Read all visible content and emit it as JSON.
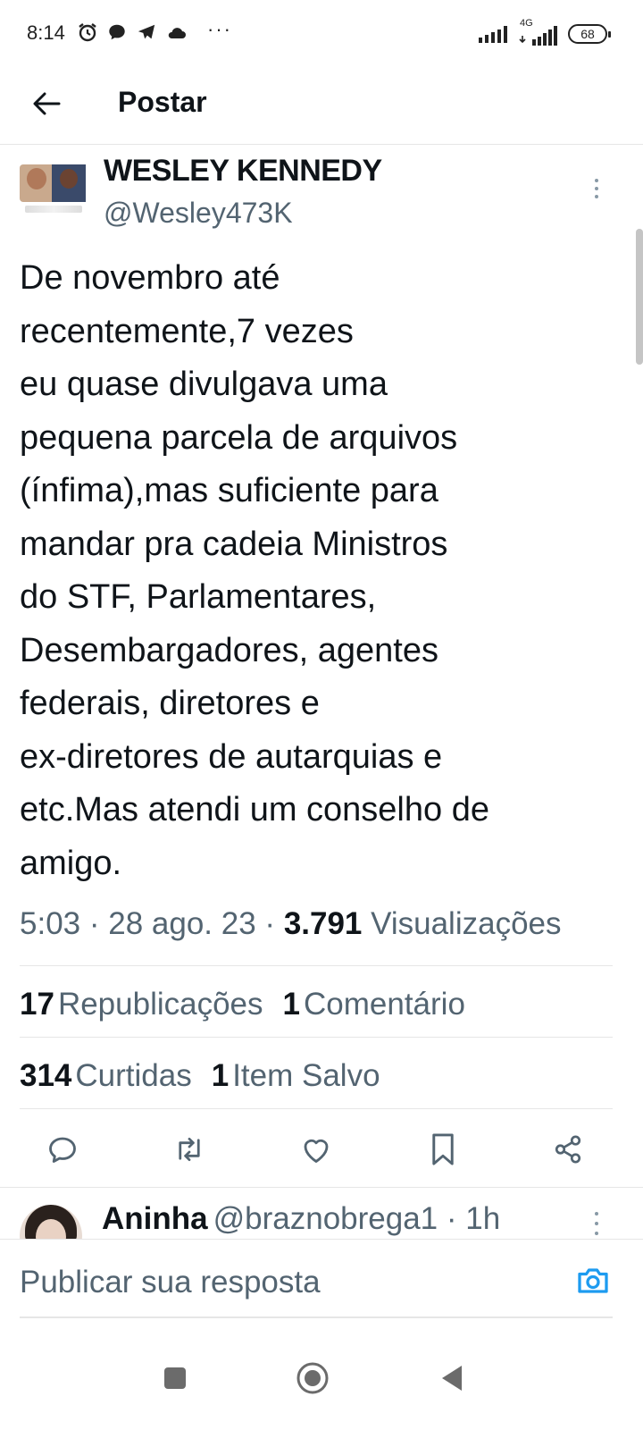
{
  "status_bar": {
    "time": "8:14",
    "network_label": "4G",
    "battery_level": "68",
    "more": "···"
  },
  "header": {
    "title": "Postar"
  },
  "tweet": {
    "author_name": "WESLEY KENNEDY",
    "author_handle": "@Wesley473K",
    "text_lines": [
      "De novembro até",
      "recentemente,7 vezes",
      "eu quase divulgava uma",
      "pequena parcela de arquivos",
      "(ínfima),mas suficiente para",
      "mandar pra cadeia Ministros",
      "do STF, Parlamentares,",
      "Desembargadores, agentes",
      "federais, diretores e",
      "ex-diretores de autarquias e",
      "etc.Mas atendi um conselho de",
      "amigo."
    ],
    "time": "5:03",
    "date": "28 ago. 23",
    "views_count": "3.791",
    "views_label": "Visualizações",
    "separator": "·"
  },
  "stats": {
    "reposts_count": "17",
    "reposts_label": "Republicações",
    "comments_count": "1",
    "comments_label": "Comentário",
    "likes_count": "314",
    "likes_label": "Curtidas",
    "saved_count": "1",
    "saved_label": "Item Salvo"
  },
  "actions": [
    "reply-icon",
    "repost-icon",
    "like-icon",
    "bookmark-icon",
    "share-icon"
  ],
  "reply_preview": {
    "name": "Aninha",
    "handle": "@braznobrega1",
    "time": "1h",
    "separator": "·"
  },
  "compose": {
    "placeholder": "Publicar sua resposta"
  },
  "colors": {
    "text_primary": "#0f1419",
    "text_secondary": "#536471",
    "accent": "#1d9bf0",
    "divider": "#e6e6e6"
  }
}
